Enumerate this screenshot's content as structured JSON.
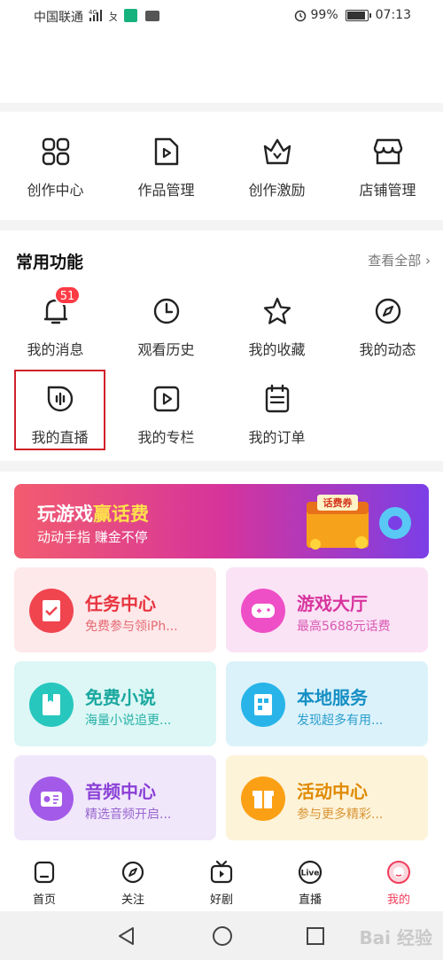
{
  "status": {
    "carrier": "中国联通",
    "network": "4G",
    "battery": "99%",
    "time": "07:13"
  },
  "creator": [
    {
      "label": "创作中心",
      "icon": "grid-icon"
    },
    {
      "label": "作品管理",
      "icon": "video-file-icon"
    },
    {
      "label": "创作激励",
      "icon": "crown-icon"
    },
    {
      "label": "店铺管理",
      "icon": "shop-icon"
    }
  ],
  "common": {
    "title": "常用功能",
    "see_all": "查看全部",
    "items": [
      {
        "label": "我的消息",
        "icon": "bell-icon",
        "badge": "51"
      },
      {
        "label": "观看历史",
        "icon": "clock-icon"
      },
      {
        "label": "我的收藏",
        "icon": "star-icon"
      },
      {
        "label": "我的动态",
        "icon": "compass-icon"
      },
      {
        "label": "我的直播",
        "icon": "live-icon"
      },
      {
        "label": "我的专栏",
        "icon": "play-square-icon"
      },
      {
        "label": "我的订单",
        "icon": "order-icon"
      }
    ]
  },
  "banner": {
    "title_a": "玩游戏",
    "title_b": "赢话费",
    "subtitle": "动动手指 赚金不停",
    "chest_label": "话费券"
  },
  "cards": [
    {
      "title": "任务中心",
      "subtitle": "免费参与领iPh...",
      "bg": "#fde8ea",
      "icon_bg": "#f0444f",
      "title_color": "#e8343f",
      "sub_color": "#e56a72",
      "icon": "task-icon"
    },
    {
      "title": "游戏大厅",
      "subtitle": "最高5688元话费",
      "bg": "#fbe3f6",
      "icon_bg": "#ef4fc6",
      "title_color": "#d8359e",
      "sub_color": "#d858b1",
      "icon": "gamepad-icon"
    },
    {
      "title": "免费小说",
      "subtitle": "海量小说追更...",
      "bg": "#dcf7f5",
      "icon_bg": "#27c7be",
      "title_color": "#1aa89f",
      "sub_color": "#27b0a8",
      "icon": "book-icon"
    },
    {
      "title": "本地服务",
      "subtitle": "发现超多有用...",
      "bg": "#dcf2fb",
      "icon_bg": "#28b4e8",
      "title_color": "#168fc4",
      "sub_color": "#2b9fcc",
      "icon": "building-icon"
    },
    {
      "title": "音频中心",
      "subtitle": "精选音频开启...",
      "bg": "#f0e7fb",
      "icon_bg": "#a35ae8",
      "title_color": "#8a3fd6",
      "sub_color": "#9a66cf",
      "icon": "radio-icon"
    },
    {
      "title": "活动中心",
      "subtitle": "参与更多精彩...",
      "bg": "#fdf3d9",
      "icon_bg": "#fba015",
      "title_color": "#e08a00",
      "sub_color": "#d99534",
      "icon": "gift-icon"
    }
  ],
  "tabs": [
    {
      "label": "首页",
      "icon": "home-icon",
      "active": false
    },
    {
      "label": "关注",
      "icon": "compass-icon",
      "active": false
    },
    {
      "label": "好剧",
      "icon": "tv-icon",
      "active": false
    },
    {
      "label": "直播",
      "icon": "live-badge-icon",
      "active": false
    },
    {
      "label": "我的",
      "icon": "profile-icon",
      "active": true
    }
  ],
  "active_color": "#f03e5c",
  "watermark": "Bai 经验"
}
